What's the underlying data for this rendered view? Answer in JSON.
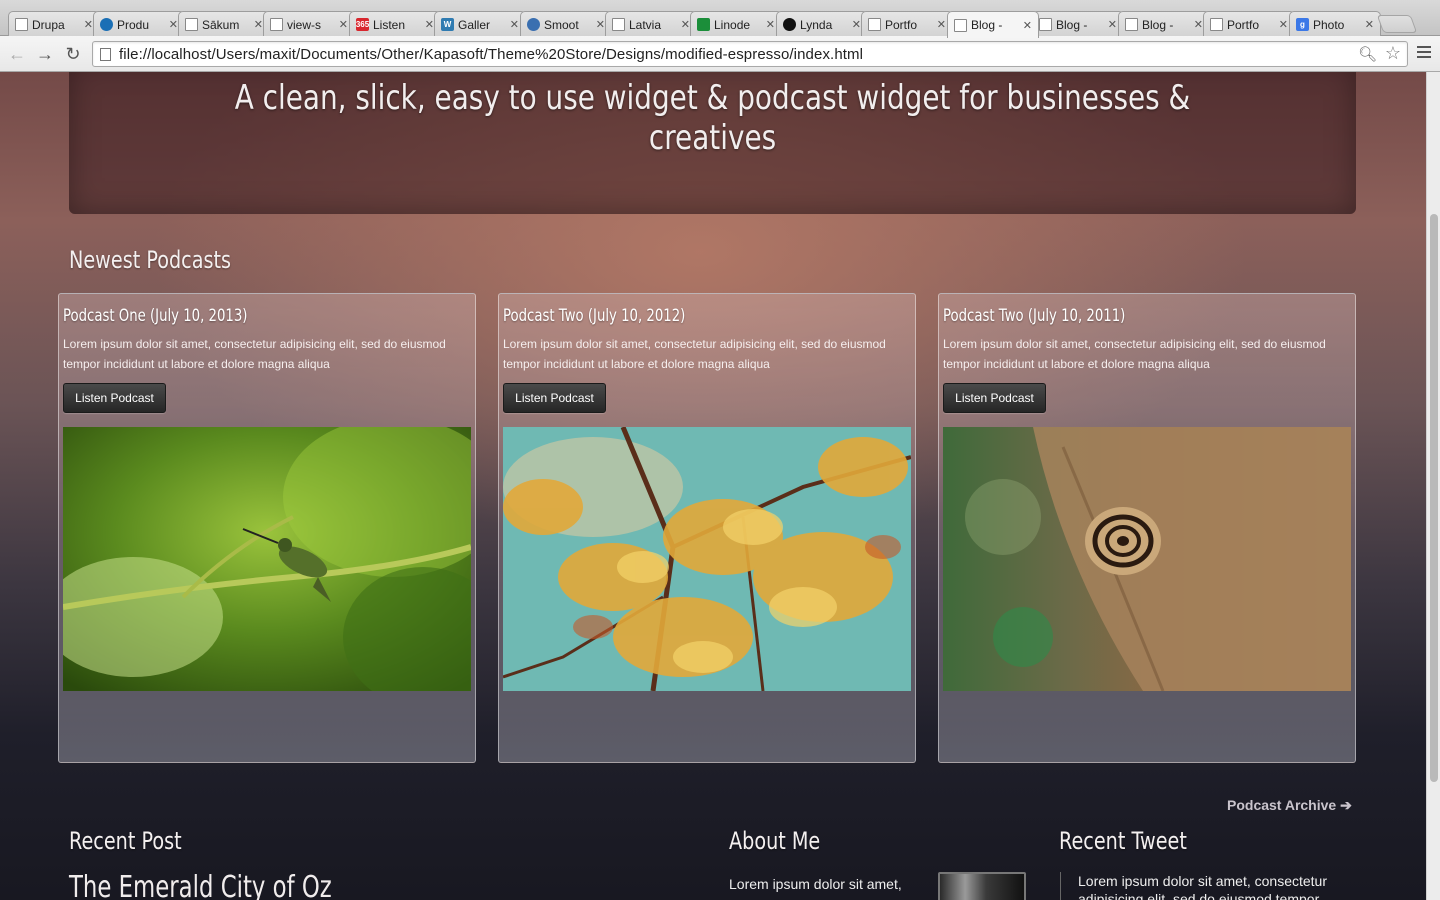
{
  "browser": {
    "tabs": [
      {
        "label": "Drupa",
        "icon": "page-icon"
      },
      {
        "label": "Produ",
        "icon": "drupal-icon"
      },
      {
        "label": "Sākum",
        "icon": "page-icon"
      },
      {
        "label": "view-s",
        "icon": "page-icon"
      },
      {
        "label": "Listen",
        "icon": "365-icon"
      },
      {
        "label": "Galler",
        "icon": "wordpress-icon"
      },
      {
        "label": "Smoot",
        "icon": "smooth-icon"
      },
      {
        "label": "Latvia",
        "icon": "page-icon"
      },
      {
        "label": "Linode",
        "icon": "linode-icon"
      },
      {
        "label": "Lynda",
        "icon": "lynda-icon"
      },
      {
        "label": "Portfo",
        "icon": "page-icon"
      },
      {
        "label": "Blog -",
        "icon": "page-icon"
      },
      {
        "label": "Blog -",
        "icon": "page-icon"
      },
      {
        "label": "Blog -",
        "icon": "page-icon"
      },
      {
        "label": "Portfo",
        "icon": "page-icon"
      },
      {
        "label": "Photo",
        "icon": "google-icon"
      }
    ],
    "active_tab_index": 11,
    "url": "file://localhost/Users/maxit/Documents/Other/Kapasoft/Theme%20Store/Designs/modified-espresso/index.html"
  },
  "page": {
    "hero_title": "A clean, slick, easy to use widget & podcast widget for businesses & creatives",
    "podcasts_heading": "Newest Podcasts",
    "podcasts": [
      {
        "title": "Podcast One (July 10, 2013)",
        "text": "Lorem ipsum dolor sit amet, consectetur adipisicing elit, sed do eiusmod tempor incididunt ut labore et dolore magna aliqua",
        "button": "Listen Podcast",
        "image": "hummingbird-photo"
      },
      {
        "title": "Podcast Two (July 10, 2012)",
        "text": "Lorem ipsum dolor sit amet, consectetur adipisicing elit, sed do eiusmod tempor incididunt ut labore et dolore magna aliqua",
        "button": "Listen Podcast",
        "image": "autumn-branches-photo"
      },
      {
        "title": "Podcast Two (July 10, 2011)",
        "text": "Lorem ipsum dolor sit amet, consectetur adipisicing elit, sed do eiusmod tempor incididunt ut labore et dolore magna aliqua",
        "button": "Listen Podcast",
        "image": "snail-photo"
      }
    ],
    "archive_link": "Podcast Archive",
    "recent_post_heading": "Recent Post",
    "recent_post_title": "The Emerald City of Oz",
    "about_heading": "About Me",
    "about_text": "Lorem ipsum dolor sit amet,",
    "tweet_heading": "Recent Tweet",
    "tweet_text": "Lorem ipsum dolor sit amet, consectetur adipisicing elit, sed do eiusmod tempor"
  }
}
